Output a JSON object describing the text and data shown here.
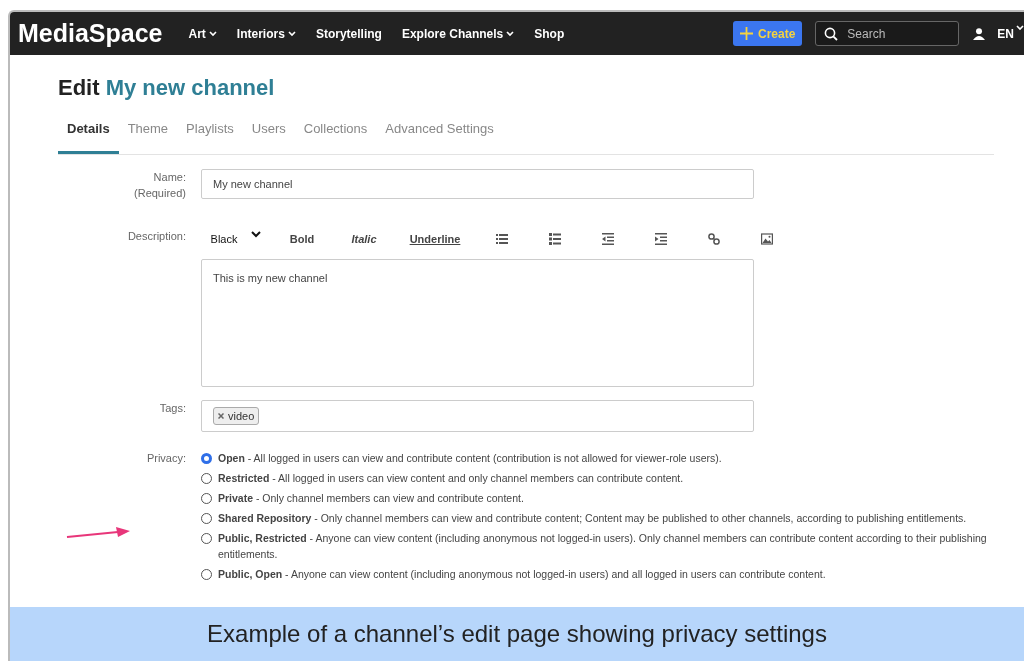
{
  "navbar": {
    "logo": "MediaSpace",
    "menu": [
      {
        "label": "Art",
        "dropdown": true
      },
      {
        "label": "Interiors",
        "dropdown": true
      },
      {
        "label": "Storytelling",
        "dropdown": false
      },
      {
        "label": "Explore Channels",
        "dropdown": true
      },
      {
        "label": "Shop",
        "dropdown": false
      }
    ],
    "create_button": "Create",
    "search": {
      "placeholder": "Search"
    },
    "language": "EN"
  },
  "heading": {
    "prefix": "Edit",
    "channel_name": "My new channel"
  },
  "tabs": [
    {
      "label": "Details",
      "selected": true
    },
    {
      "label": "Theme",
      "selected": false
    },
    {
      "label": "Playlists",
      "selected": false
    },
    {
      "label": "Users",
      "selected": false
    },
    {
      "label": "Collections",
      "selected": false
    },
    {
      "label": "Advanced Settings",
      "selected": false
    }
  ],
  "form": {
    "name_label": "Name:",
    "name_required": "(Required)",
    "name_value": "My new channel",
    "description_label": "Description:",
    "toolbar": [
      {
        "kind": "select",
        "label": "Black"
      },
      {
        "kind": "bold",
        "label": "Bold"
      },
      {
        "kind": "italic",
        "label": "Italic"
      },
      {
        "kind": "underline",
        "label": "Underline"
      },
      {
        "kind": "bullet-list"
      },
      {
        "kind": "bullet-list-bold"
      },
      {
        "kind": "outdent"
      },
      {
        "kind": "indent"
      },
      {
        "kind": "link"
      },
      {
        "kind": "image"
      }
    ],
    "description_value": "This is my new channel",
    "tags_label": "Tags:",
    "tags": [
      "video"
    ],
    "privacy_label": "Privacy:",
    "privacy_options": [
      {
        "text": "**Open** - All logged in users can view and contribute content (contribution is not allowed for viewer-role users).",
        "selected": true
      },
      {
        "text": "**Restricted** - All logged in users can view content and only channel members can contribute content.",
        "selected": false
      },
      {
        "text": "**Private** - Only channel members can view and contribute content.",
        "selected": false
      },
      {
        "text": "**Shared Repository** - Only channel members can view and contribute content; Content may be published to other channels, according to publishing entitlements.",
        "selected": false
      },
      {
        "text": "**Public, Restricted** - Anyone can view content (including anonymous not logged-in users). Only channel members can contribute content according to their publishing entitlements.",
        "selected": false
      },
      {
        "text": "**Public, Open** - Anyone can view content (including anonymous not logged-in users) and all logged in users can contribute content.",
        "selected": false
      }
    ]
  },
  "caption": "Example of a channel’s edit page showing privacy settings"
}
